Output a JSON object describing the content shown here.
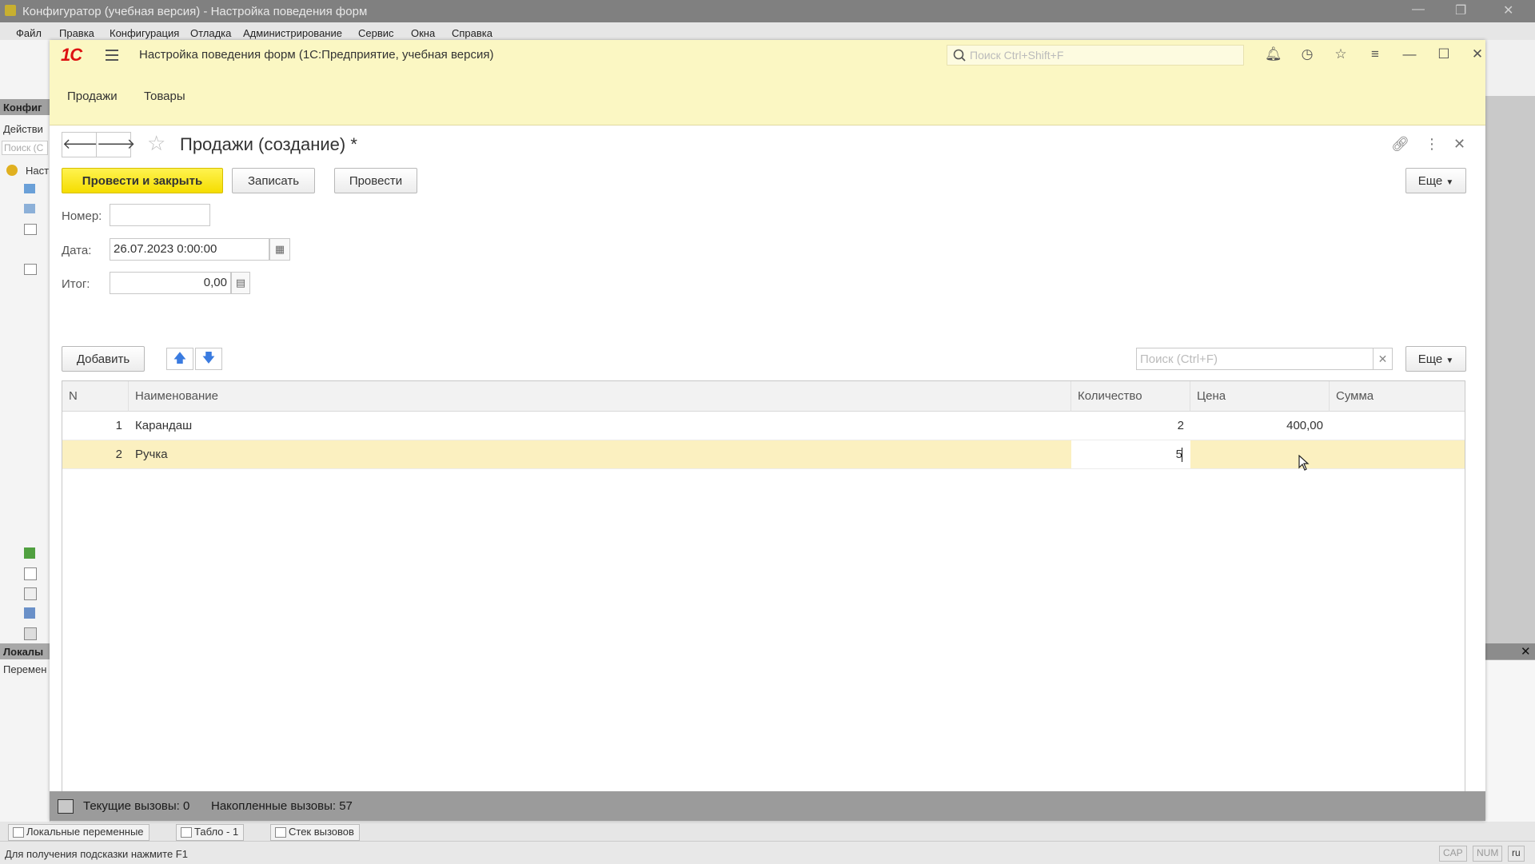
{
  "configurator": {
    "title": "Конфигуратор (учебная версия) - Настройка поведения форм",
    "menu": [
      "Файл",
      "Правка",
      "Конфигурация",
      "Отладка",
      "Администрирование",
      "Сервис",
      "Окна",
      "Справка"
    ],
    "left_labels": {
      "conf": "Конфиг",
      "actions": "Действи",
      "search": "Поиск (С",
      "root": "Наст",
      "locals_head": "Локалы",
      "locals_var": "Перемен"
    },
    "bottom_tabs": [
      "Локальные переменные",
      "Табло - 1",
      "Стек вызовов"
    ],
    "status_hint": "Для получения подсказки нажмите F1",
    "indicators": [
      "CAP",
      "NUM",
      "ru"
    ]
  },
  "window": {
    "title": "Настройка поведения форм  (1С:Предприятие, учебная версия)",
    "logo": "1С",
    "search_placeholder": "Поиск Ctrl+Shift+F",
    "sections": [
      "Продажи",
      "Товары"
    ]
  },
  "form": {
    "title": "Продажи (создание) *",
    "buttons": {
      "post_close": "Провести и закрыть",
      "save": "Записать",
      "post": "Провести",
      "more": "Еще"
    },
    "fields": {
      "number_label": "Номер:",
      "number_value": "",
      "date_label": "Дата:",
      "date_value": "26.07.2023  0:00:00",
      "total_label": "Итог:",
      "total_value": "0,00"
    },
    "table_toolbar": {
      "add": "Добавить",
      "search_placeholder": "Поиск (Ctrl+F)",
      "more": "Еще"
    },
    "table": {
      "columns": [
        "N",
        "Наименование",
        "Количество",
        "Цена",
        "Сумма"
      ],
      "rows": [
        {
          "n": "1",
          "name": "Карандаш",
          "qty": "2",
          "price": "400,00",
          "sum": ""
        },
        {
          "n": "2",
          "name": "Ручка",
          "qty": "5",
          "price": "",
          "sum": ""
        }
      ]
    }
  },
  "debug": {
    "current": "Текущие вызовы: 0",
    "accumulated": "Накопленные вызовы: 57"
  },
  "colors": {
    "accent_yellow": "#f5dd00",
    "title_bar": "#fbf7c3",
    "selected_row": "#fbf0c0",
    "logo_red": "#dd1111"
  }
}
